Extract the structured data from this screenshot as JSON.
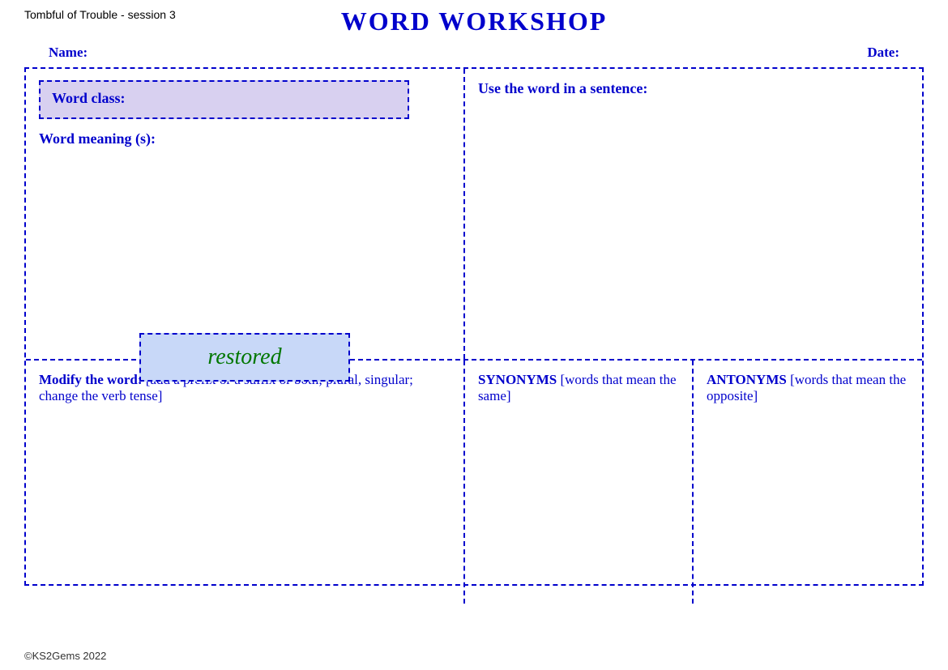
{
  "session_label": "Tombful of Trouble - session 3",
  "page_title": "WORD WORKSHOP",
  "name_label": "Name:",
  "date_label": "Date:",
  "word_class_label": "Word class:",
  "word_meaning_label": "Word meaning (s):",
  "use_sentence_label": "Use the word in a sentence:",
  "center_word": "restored",
  "modify_label_bold": "Modify the word:",
  "modify_label_normal": " [add a prefix or a suffix or both; plural, singular; change the verb tense]",
  "synonyms_label_bold": "SYNONYMS",
  "synonyms_label_normal": " [words that mean the same]",
  "antonyms_label_bold": "ANTONYMS",
  "antonyms_label_normal": " [words that mean the opposite]",
  "copyright": "©KS2Gems 2022"
}
